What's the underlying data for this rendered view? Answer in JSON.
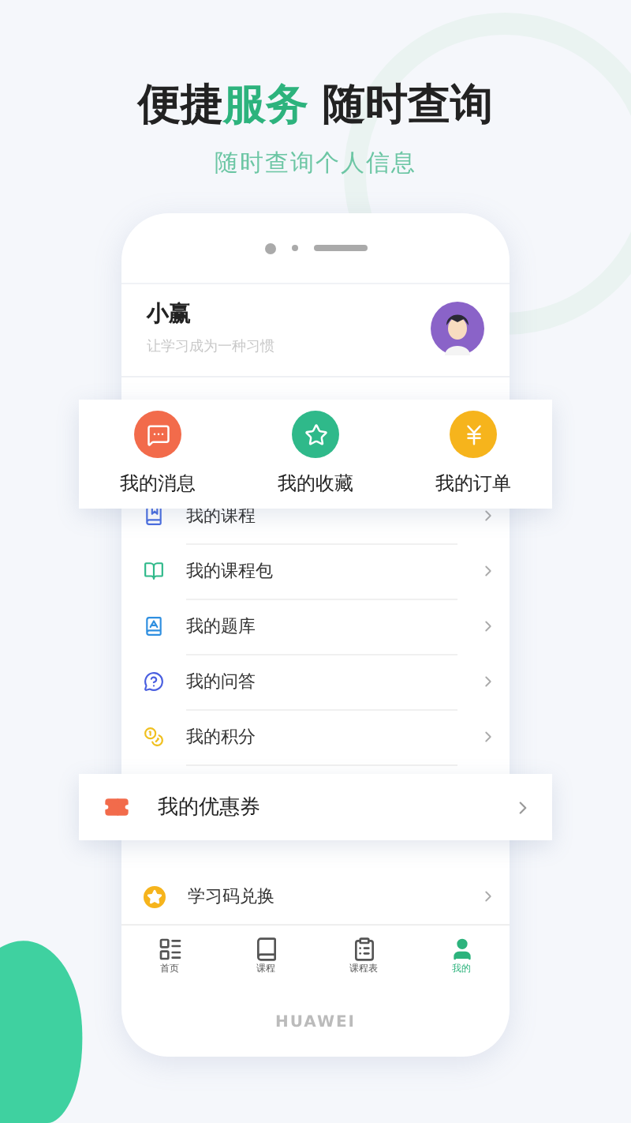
{
  "headline": [
    {
      "text": "便捷",
      "accent": false
    },
    {
      "text": "服务",
      "accent": true
    },
    {
      "text": " 随时查询",
      "accent": false
    }
  ],
  "subtitle": "随时查询个人信息",
  "profile": {
    "name": "小赢",
    "motto": "让学习成为一种习惯"
  },
  "shortcuts": [
    {
      "label": "我的消息",
      "kind": "message",
      "color": "#f26b4b"
    },
    {
      "label": "我的收藏",
      "kind": "favorite",
      "color": "#2fb98a"
    },
    {
      "label": "我的订单",
      "kind": "order",
      "color": "#f6b41c"
    }
  ],
  "menu": [
    {
      "label": "我的课程",
      "kind": "course"
    },
    {
      "label": "我的课程包",
      "kind": "package"
    },
    {
      "label": "我的题库",
      "kind": "bank"
    },
    {
      "label": "我的问答",
      "kind": "qa"
    },
    {
      "label": "我的积分",
      "kind": "points"
    },
    {
      "label": "学习码兑换",
      "kind": "code"
    }
  ],
  "coupon_popout": {
    "label": "我的优惠券"
  },
  "tabs": [
    {
      "label": "首页",
      "kind": "home",
      "selected": false
    },
    {
      "label": "课程",
      "kind": "course",
      "selected": false
    },
    {
      "label": "课程表",
      "kind": "schedule",
      "selected": false
    },
    {
      "label": "我的",
      "kind": "me",
      "selected": true
    }
  ],
  "brand": "HUAWEI"
}
